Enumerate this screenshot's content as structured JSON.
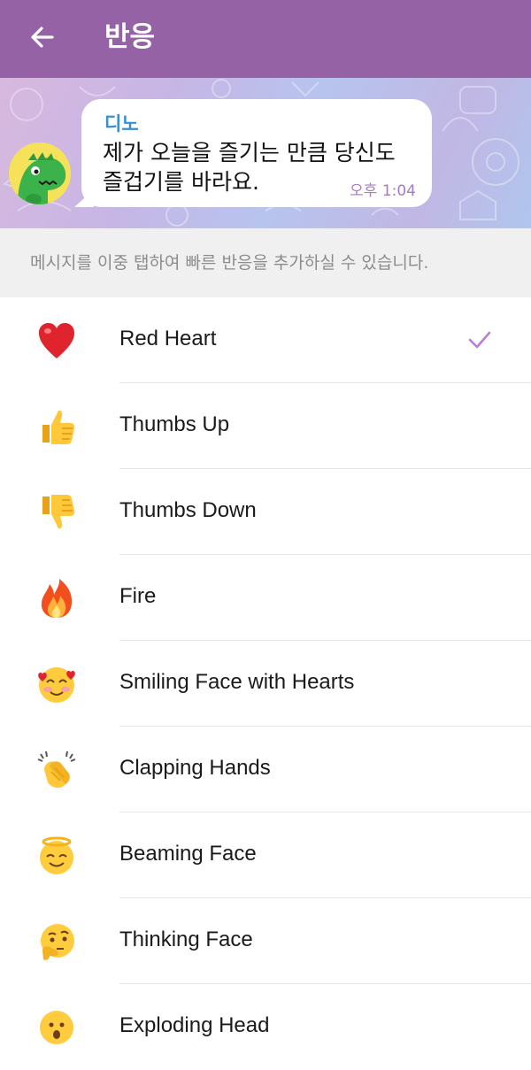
{
  "header": {
    "title": "반응",
    "back_icon": "arrow-left-icon",
    "background": "#9562a6"
  },
  "preview": {
    "sender": "디노",
    "message_line1": "제가 오늘을 즐기는 만큼 당신도",
    "message_line2": "즐겁기를 바라요.",
    "time": "오후 1:04",
    "avatar_icon": "dino-avatar-icon"
  },
  "hint": "메시지를 이중 탭하여 빠른 반응을 추가하실 수 있습니다.",
  "reactions": [
    {
      "label": "Red Heart",
      "icon": "red-heart-icon",
      "selected": true
    },
    {
      "label": "Thumbs Up",
      "icon": "thumbs-up-icon",
      "selected": false
    },
    {
      "label": "Thumbs Down",
      "icon": "thumbs-down-icon",
      "selected": false
    },
    {
      "label": "Fire",
      "icon": "fire-icon",
      "selected": false
    },
    {
      "label": "Smiling Face with Hearts",
      "icon": "smiling-face-hearts-icon",
      "selected": false
    },
    {
      "label": "Clapping Hands",
      "icon": "clapping-hands-icon",
      "selected": false
    },
    {
      "label": "Beaming Face",
      "icon": "beaming-face-icon",
      "selected": false
    },
    {
      "label": "Thinking Face",
      "icon": "thinking-face-icon",
      "selected": false
    },
    {
      "label": "Exploding Head",
      "icon": "exploding-head-icon",
      "selected": false
    }
  ],
  "colors": {
    "accent": "#9562a6",
    "check": "#b77fd6",
    "sender": "#3a8ed1"
  }
}
